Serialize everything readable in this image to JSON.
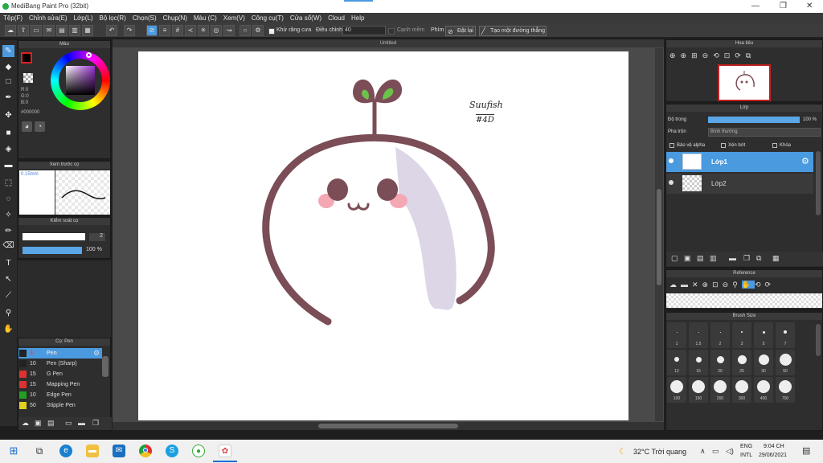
{
  "window": {
    "title": "MediBang Paint Pro (32bit)"
  },
  "menu": [
    "Tệp(F)",
    "Chỉnh sửa(E)",
    "Lớp(L)",
    "Bộ lọc(R)",
    "Chọn(S)",
    "Chụp(N)",
    "Màu (C)",
    "Xem(V)",
    "Công cụ(T)",
    "Cửa sổ(W)",
    "Cloud",
    "Help"
  ],
  "toolbar": {
    "antialias_label": "Khử răng cưa",
    "adjust_label": "Điều chỉnh",
    "adjust_value": "40",
    "edge_label": "Cạnh mềm",
    "key_label": "Phím",
    "reset_label": "Đặt lại",
    "straight_label": "Tạo một đường thẳng"
  },
  "color_panel": {
    "title": "Màu",
    "r": "R:0",
    "g": "G:0",
    "b": "B:0",
    "hex": "#000000",
    "hue_color": "#2a1640"
  },
  "preview_panel": {
    "title": "Xem trước cọ",
    "size": "0.15mm"
  },
  "brush_control": {
    "title": "Kiểm soát cọ",
    "size": "2",
    "opacity": "100 %"
  },
  "brush_panel": {
    "title": "Cọ: Pen",
    "brushes": [
      {
        "size": "3",
        "name": "Pen",
        "color": "#222222",
        "selected": true
      },
      {
        "size": "10",
        "name": "Pen (Sharp)",
        "color": "#222222",
        "selected": false
      },
      {
        "size": "15",
        "name": "G Pen",
        "color": "#e03030",
        "selected": false
      },
      {
        "size": "15",
        "name": "Mapping Pen",
        "color": "#e03030",
        "selected": false
      },
      {
        "size": "10",
        "name": "Edge Pen",
        "color": "#20a020",
        "selected": false
      },
      {
        "size": "50",
        "name": "Stipple Pen",
        "color": "#e0d020",
        "selected": false
      }
    ]
  },
  "canvas": {
    "title": "Untitled",
    "signature_1": "Suufish",
    "signature_2": "#4D"
  },
  "navigator": {
    "title": "Hoa tiêu"
  },
  "layer_panel": {
    "title": "Lớp",
    "opacity_label": "Độ trong",
    "opacity_value": "100 %",
    "blend_label": "Pha trộn",
    "blend_value": "Bình thường",
    "protect_alpha": "Bảo vệ alpha",
    "clip": "Xén bớt",
    "lock": "Khóa",
    "layers": [
      {
        "name": "Lớp1",
        "selected": true
      },
      {
        "name": "Lớp2",
        "selected": false
      }
    ]
  },
  "reference_panel": {
    "title": "Reference"
  },
  "brush_size_panel": {
    "title": "Brush Size",
    "row1": [
      "1",
      "1.5",
      "2",
      "3",
      "5",
      "7"
    ],
    "row2": [
      "12",
      "15",
      "20",
      "25",
      "30",
      "50"
    ],
    "row3": [
      "100",
      "150",
      "200",
      "300",
      "400",
      "700"
    ]
  },
  "taskbar": {
    "weather": "32°C Trời quang",
    "lang1": "ENG",
    "lang2": "INTL",
    "time": "9:04 CH",
    "date": "29/06/2021"
  }
}
